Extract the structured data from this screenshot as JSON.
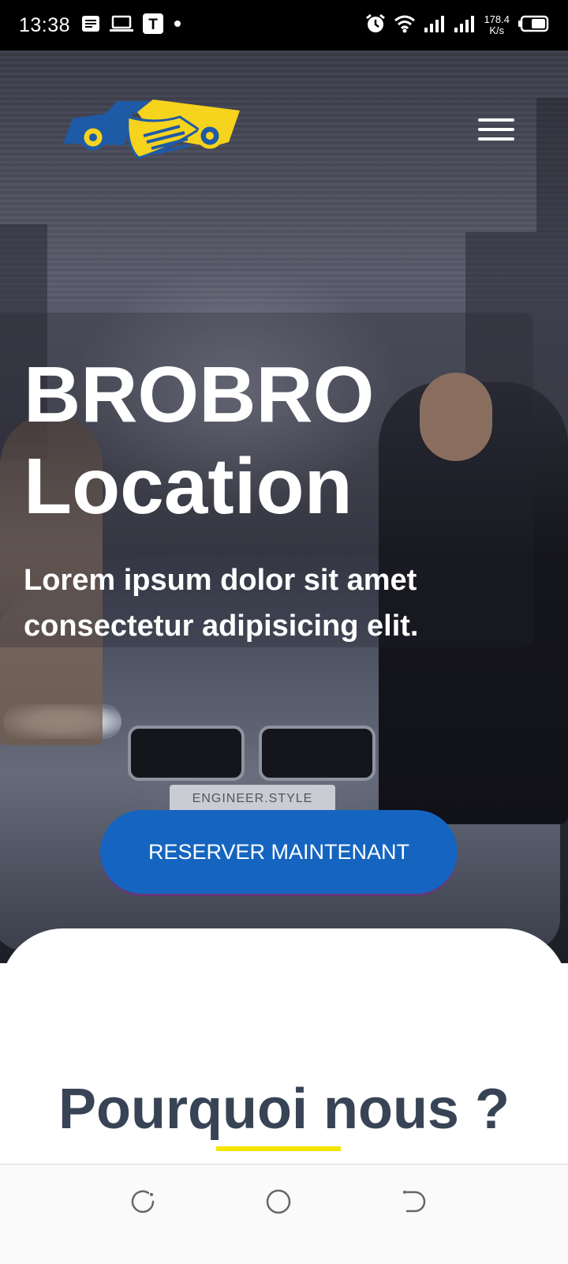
{
  "status_bar": {
    "time": "13:38",
    "speed_value": "178.4",
    "speed_unit": "K/s",
    "notif_t_label": "T",
    "icons": [
      "notes-icon",
      "laptop-icon",
      "t-app-icon",
      "dot-icon",
      "alarm-icon",
      "wifi-icon",
      "signal-icon",
      "signal-icon-2",
      "battery-icon"
    ]
  },
  "hero": {
    "title_line1": "BROBRO",
    "title_line2": "Location",
    "subtitle_line1": "Lorem ipsum dolor sit amet",
    "subtitle_line2": "consectetur adipisicing elit.",
    "plate_text": "ENGINEER.STYLE",
    "cta_label": "RESERVER MAINTENANT"
  },
  "logo": {
    "colors": {
      "blue": "#1f5aa6",
      "yellow": "#f6d31c"
    }
  },
  "section": {
    "title": "Pourquoi nous ?",
    "underline_color": "#f4e400"
  },
  "colors": {
    "cta": "#1565c0",
    "title_text": "#384455"
  },
  "nav_bar": {
    "icons": [
      "recent-apps-icon",
      "home-icon",
      "back-icon"
    ]
  }
}
